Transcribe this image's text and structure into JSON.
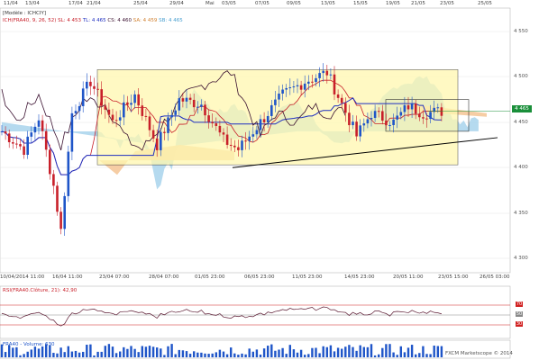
{
  "top_dates": [
    "11/04",
    "13/04",
    "17/04",
    "21/04",
    "25/04",
    "29/04",
    "Mai",
    "03/05",
    "07/05",
    "09/05",
    "13/05",
    "15/05",
    "19/05",
    "21/05",
    "23/05",
    "25/05"
  ],
  "bottom_dates": [
    "10/04/2014 11:00",
    "16/04 11:00",
    "23/04 07:00",
    "28/04 07:00",
    "01/05 23:00",
    "06/05 23:00",
    "11/05 23:00",
    "14/05 23:00",
    "20/05 11:00",
    "23/05 15:00",
    "26/05 03:00"
  ],
  "price_labels": [
    "4 550",
    "4 500",
    "4 450",
    "4 400",
    "4 350",
    "4 300"
  ],
  "current_price": "4 465",
  "header": {
    "model": "[Modèle : ICHCIY]",
    "ichimoku": "ICH(FRA40, 9, 26, 52)",
    "sl": "SL: 4 453",
    "tl": "TL: 4 465",
    "cs": "CS: 4 460",
    "sa": "SA: 4 459",
    "sb": "SB: 4 465"
  },
  "rsi": {
    "label": "RSI(FRA40.Clôture, 21): 42,90",
    "levels": [
      "70",
      "50",
      "30"
    ],
    "level_colors": [
      "#d02020",
      "#888888",
      "#d02020"
    ]
  },
  "volume": {
    "label": "FRA40 - Volume: 630"
  },
  "watermark": "FXCM Marketscope © 2014",
  "colors": {
    "bull": "#1f55c8",
    "bear": "#c8202a",
    "tenkan": "#c8202a",
    "kijun": "#1f2fc0",
    "chikou": "#3a1030",
    "kumo_bull": "#a8d4ec",
    "kumo_bear": "#f5c89a",
    "box": "#fff8b0",
    "price_tag": "#1a8f3a"
  }
}
